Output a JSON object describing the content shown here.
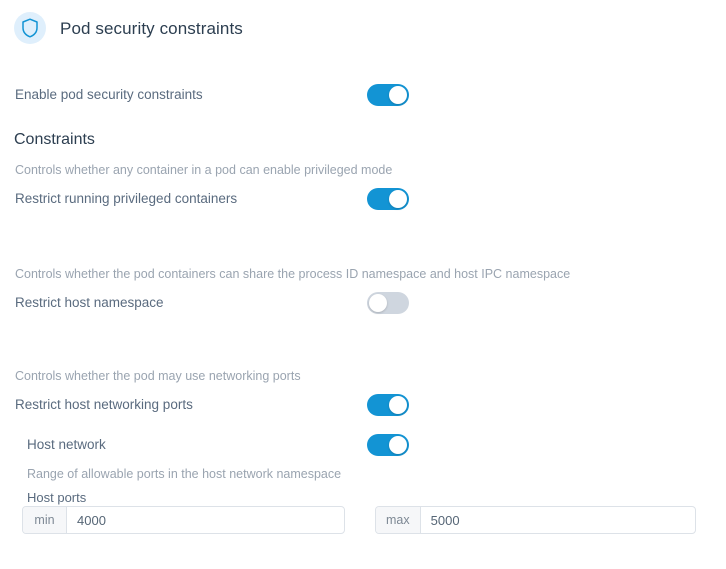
{
  "header": {
    "title": "Pod security constraints",
    "icon": "shield-icon",
    "icon_color": "#1394d4",
    "icon_bg": "#dfeffc"
  },
  "colors": {
    "toggle_on": "#1394d4",
    "toggle_off": "#cfd6df",
    "label": "#5a6b7f",
    "heading": "#2c3e50",
    "description": "#9aa4b0"
  },
  "enable_row": {
    "label": "Enable pod security constraints",
    "toggle_state": "on"
  },
  "constraints": {
    "heading": "Constraints",
    "items": [
      {
        "description": "Controls whether any container in a pod can enable privileged mode",
        "label": "Restrict running privileged containers",
        "toggle_state": "on"
      },
      {
        "description": "Controls whether the pod containers can share the process ID namespace and host IPC namespace",
        "label": "Restrict host namespace",
        "toggle_state": "off"
      },
      {
        "description": "Controls whether the pod may use networking ports",
        "label": "Restrict host networking ports",
        "toggle_state": "on"
      }
    ]
  },
  "host_network": {
    "label": "Host network",
    "toggle_state": "on",
    "description": "Range of allowable ports in the host network namespace",
    "ports_label": "Host ports",
    "min": {
      "prefix": "min",
      "value": "4000",
      "placeholder": "min"
    },
    "max": {
      "prefix": "max",
      "value": "5000",
      "placeholder": "max"
    }
  }
}
